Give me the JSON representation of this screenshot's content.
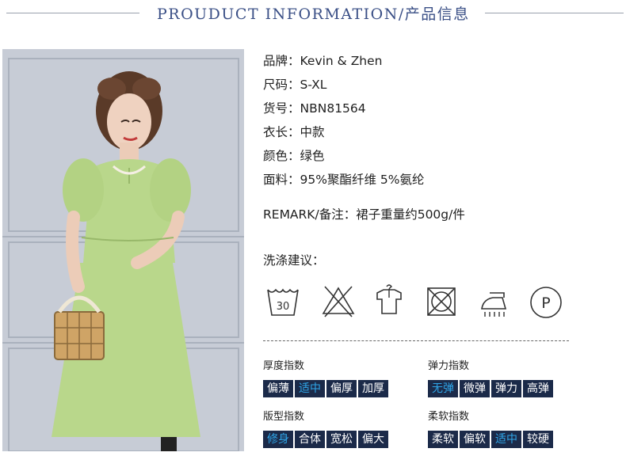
{
  "header": {
    "title": "PROUDUCT INFORMATION/产品信息"
  },
  "info": {
    "rows": [
      {
        "label": "品牌：",
        "value": "Kevin & Zhen"
      },
      {
        "label": "尺码：",
        "value": "S-XL"
      },
      {
        "label": "货号：",
        "value": "NBN81564"
      },
      {
        "label": "衣长：",
        "value": "中款"
      },
      {
        "label": "颜色：",
        "value": "绿色"
      },
      {
        "label": "面料：",
        "value": "95%聚酯纤维 5%氨纶"
      }
    ],
    "remark_label": "REMARK/备注：",
    "remark_value": "裙子重量约500g/件"
  },
  "wash": {
    "title": "洗涤建议：",
    "icons": [
      {
        "name": "wash-30-icon",
        "text": "30"
      },
      {
        "name": "no-bleach-icon"
      },
      {
        "name": "hang-dry-icon"
      },
      {
        "name": "no-tumble-dry-icon"
      },
      {
        "name": "iron-icon"
      },
      {
        "name": "dry-clean-p-icon",
        "text": "P"
      }
    ]
  },
  "indices": {
    "thickness": {
      "label": "厚度指数",
      "options": [
        "偏薄",
        "适中",
        "偏厚",
        "加厚"
      ],
      "selected": 1
    },
    "elasticity": {
      "label": "弹力指数",
      "options": [
        "无弹",
        "微弹",
        "弹力",
        "高弹"
      ],
      "selected": 0
    },
    "fit": {
      "label": "版型指数",
      "options": [
        "修身",
        "合体",
        "宽松",
        "偏大"
      ],
      "selected": 0
    },
    "softness": {
      "label": "柔软指数",
      "options": [
        "柔软",
        "偏软",
        "适中",
        "较硬"
      ],
      "selected": 2
    }
  },
  "colors": {
    "title": "#3a4f86",
    "tag_bg": "#1b2a49",
    "tag_selected_text": "#2fa6e8",
    "dress": "#b9d78b"
  }
}
